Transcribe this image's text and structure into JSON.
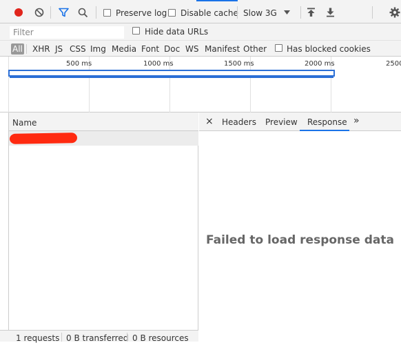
{
  "toolbar": {
    "preserve_log_label": "Preserve log",
    "disable_cache_label": "Disable cache",
    "throttle_value": "Slow 3G",
    "colors": {
      "record": "#e0251c",
      "filter_active": "#1a73e8"
    }
  },
  "filter": {
    "placeholder": "Filter",
    "hide_data_urls_label": "Hide data URLs"
  },
  "types": [
    "All",
    "XHR",
    "JS",
    "CSS",
    "Img",
    "Media",
    "Font",
    "Doc",
    "WS",
    "Manifest",
    "Other"
  ],
  "has_blocked_cookies_label": "Has blocked cookies",
  "timeline": {
    "ticks": [
      "500 ms",
      "1000 ms",
      "1500 ms",
      "2000 ms",
      "2500"
    ]
  },
  "request_list": {
    "header": "Name",
    "redaction_color": "#ff2a10"
  },
  "status": {
    "requests": "1 requests",
    "transferred": "0 B transferred",
    "resources": "0 B resources"
  },
  "detail": {
    "close_symbol": "×",
    "tabs": [
      "Headers",
      "Preview",
      "Response"
    ],
    "more_symbol": "»",
    "active_tab": "Response",
    "message": "Failed to load response data"
  }
}
